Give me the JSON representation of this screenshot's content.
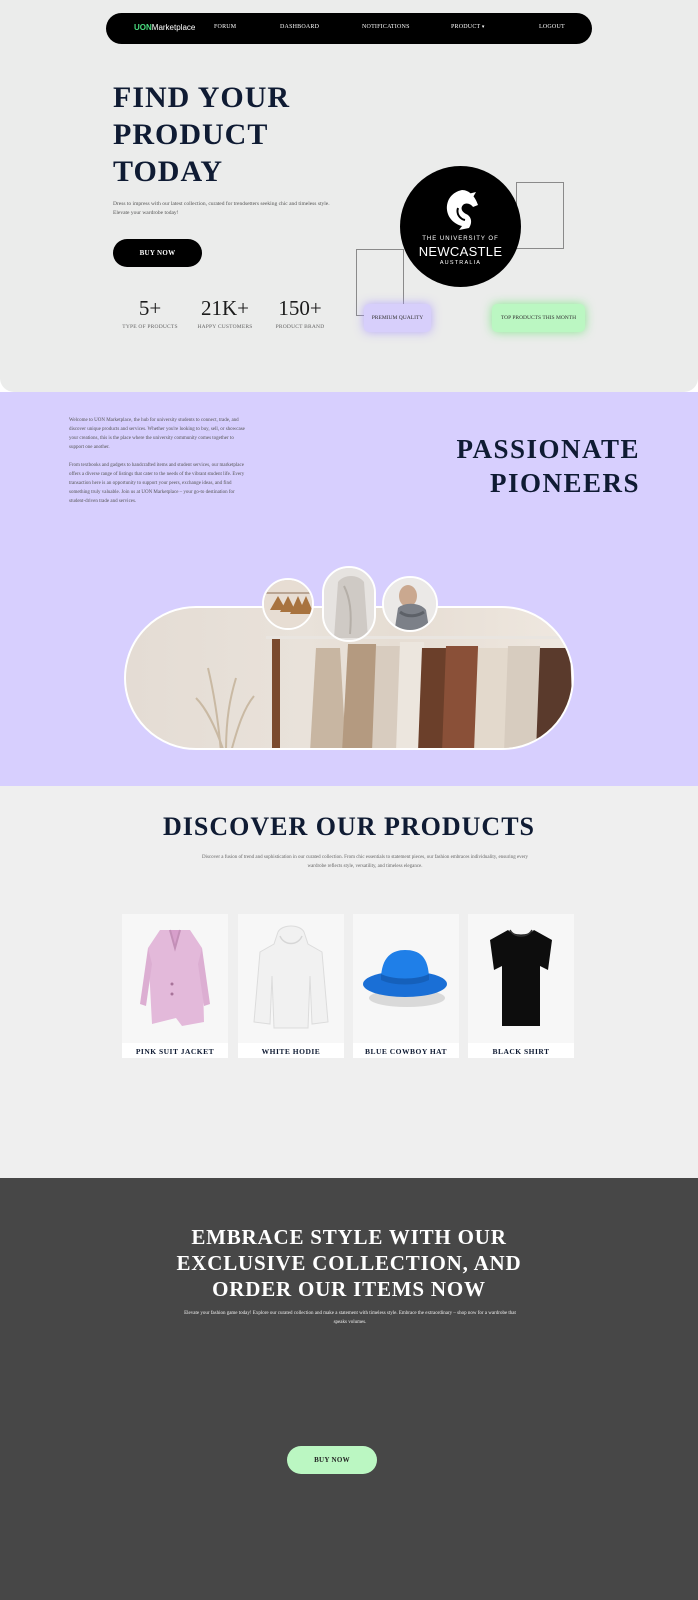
{
  "nav": {
    "brand_accent": "UON",
    "brand_rest": "Marketplace",
    "items": [
      "FORUM",
      "DASHBOARD",
      "NOTIFICATIONS",
      "PRODUCT",
      "LOGOUT"
    ]
  },
  "hero": {
    "title_lines": [
      "FIND YOUR",
      "PRODUCT",
      "TODAY"
    ],
    "description": "Dress to impress with our latest collection, curated for trendsetters seeking chic and timeless style. Elevate your wardrobe today!",
    "cta_label": "BUY NOW",
    "stats": [
      {
        "value": "5+",
        "label": "TYPE OF PRODUCTS"
      },
      {
        "value": "21K+",
        "label": "HAPPY CUSTOMERS"
      },
      {
        "value": "150+",
        "label": "PRODUCT BRAND"
      }
    ],
    "logo": {
      "line1": "THE UNIVERSITY OF",
      "line2": "NEWCASTLE",
      "line3": "AUSTRALIA"
    },
    "badges": {
      "premium": "PREMIUM QUALITY",
      "top": "TOP PRODUCTS THIS MONTH"
    }
  },
  "about": {
    "paragraphs": [
      "Welcome to UON Marketplace, the hub for university students to connect, trade, and discover unique products and services. Whether you're looking to buy, sell, or showcase your creations, this is the place where the university community comes together to support one another.",
      "From textbooks and gadgets to handcrafted items and student services, our marketplace offers a diverse range of listings that cater to the needs of the vibrant student life. Every transaction here is an opportunity to support your peers, exchange ideas, and find something truly valuable. Join us at UON Marketplace – your go-to destination for student-driven trade and services."
    ],
    "title_lines": [
      "PASSIONATE",
      "PIONEERS"
    ]
  },
  "products": {
    "title": "DISCOVER OUR PRODUCTS",
    "description": "Discover a fusion of trend and sophistication in our curated collection. From chic essentials to statement pieces, our fashion embraces individuality, ensuring every wardrobe reflects style, versatility, and timeless elegance.",
    "items": [
      {
        "name": "PINK SUIT JACKET",
        "icon": "pink-jacket-image"
      },
      {
        "name": "WHITE HODIE",
        "icon": "white-hoodie-image"
      },
      {
        "name": "BLUE COWBOY HAT",
        "icon": "blue-hat-image"
      },
      {
        "name": "BLACK SHIRT",
        "icon": "black-shirt-image"
      }
    ]
  },
  "cta": {
    "title_lines": [
      "EMBRACE STYLE WITH OUR",
      "EXCLUSIVE COLLECTION, AND",
      "ORDER OUR ITEMS NOW"
    ],
    "description": "Elevate your fashion game today! Explore our curated collection and make a statement with timeless style. Embrace the extraordinary – shop now for a wardrobe that speaks volumes.",
    "button_label": "BUY NOW"
  },
  "colors": {
    "hero_bg": "#ebeceb",
    "about_bg": "#d7cffe",
    "products_bg": "#efefef",
    "cta_bg": "#474747",
    "brand_green": "#4ade80",
    "badge_purple": "#d7cffb",
    "badge_green": "#bbf7c2",
    "navy_text": "#0f1b33"
  }
}
